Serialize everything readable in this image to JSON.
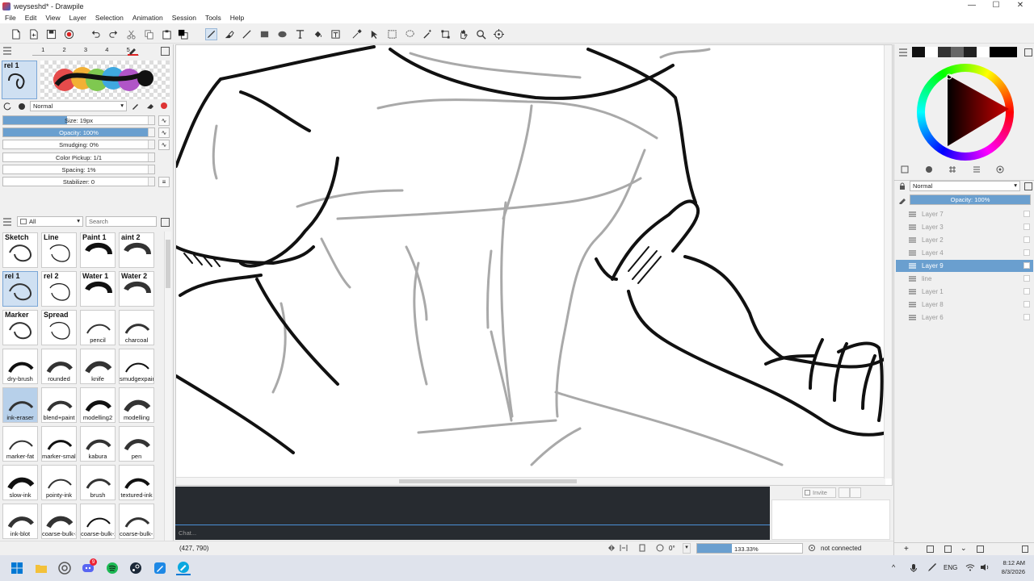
{
  "window": {
    "title": "weyseshd* - Drawpile",
    "min": "—",
    "max": "☐",
    "close": "✕"
  },
  "menu": [
    "File",
    "Edit",
    "View",
    "Layer",
    "Selection",
    "Animation",
    "Session",
    "Tools",
    "Help"
  ],
  "brush_editor": {
    "preset_label": "rel 1",
    "slot_numbers": [
      "1",
      "2",
      "3",
      "4",
      "5"
    ],
    "blend_mode": "Normal",
    "sliders": [
      {
        "label": "Size: 19px",
        "value": 0.42
      },
      {
        "label": "Opacity: 100%",
        "value": 1.0
      },
      {
        "label": "Smudging: 0%",
        "value": 0
      },
      {
        "label": "Color Pickup: 1/1",
        "value": 0
      },
      {
        "label": "Spacing: 1%",
        "value": 0
      },
      {
        "label": "Stabilizer: 0",
        "value": 0
      }
    ]
  },
  "brush_library": {
    "filter": "All",
    "search_placeholder": "Search",
    "brushes": [
      {
        "top": "Sketch",
        "bottom": ""
      },
      {
        "top": "Line",
        "bottom": ""
      },
      {
        "top": "Paint 1",
        "bottom": ""
      },
      {
        "top": "aint 2",
        "bottom": ""
      },
      {
        "top": "rel 1",
        "bottom": ""
      },
      {
        "top": "rel 2",
        "bottom": ""
      },
      {
        "top": "Water 1",
        "bottom": ""
      },
      {
        "top": "Water 2",
        "bottom": ""
      },
      {
        "top": "Marker",
        "bottom": ""
      },
      {
        "top": "Spread",
        "bottom": ""
      },
      {
        "top": "",
        "bottom": "pencil"
      },
      {
        "top": "",
        "bottom": "charcoal"
      },
      {
        "top": "",
        "bottom": "dry-brush"
      },
      {
        "top": "",
        "bottom": "rounded"
      },
      {
        "top": "",
        "bottom": "knife"
      },
      {
        "top": "",
        "bottom": "smudgexpaint"
      },
      {
        "top": "",
        "bottom": "ink-eraser"
      },
      {
        "top": "",
        "bottom": "blend+paint"
      },
      {
        "top": "",
        "bottom": "modelling2"
      },
      {
        "top": "",
        "bottom": "modelling"
      },
      {
        "top": "",
        "bottom": "marker-fat"
      },
      {
        "top": "",
        "bottom": "marker-small"
      },
      {
        "top": "",
        "bottom": "kabura"
      },
      {
        "top": "",
        "bottom": "pen"
      },
      {
        "top": "",
        "bottom": "slow-ink"
      },
      {
        "top": "",
        "bottom": "pointy-ink"
      },
      {
        "top": "",
        "bottom": "brush"
      },
      {
        "top": "",
        "bottom": "textured-ink"
      },
      {
        "top": "",
        "bottom": "ink-blot"
      },
      {
        "top": "",
        "bottom": "coarse-bulk-3"
      },
      {
        "top": "",
        "bottom": "coarse-bulk-2"
      },
      {
        "top": "",
        "bottom": "coarse-bulk-1"
      }
    ]
  },
  "chat": {
    "placeholder": "Chat...",
    "invite_label": "Invite"
  },
  "status": {
    "coords": "(427, 790)",
    "rotation": "0°",
    "zoom": "133.33%",
    "zoom_level": 0.33,
    "connection": "not connected"
  },
  "layers_panel": {
    "blend_mode": "Normal",
    "opacity_label": "Opacity: 100%",
    "layers": [
      {
        "name": "Layer 7",
        "selected": false
      },
      {
        "name": "Layer 3",
        "selected": false
      },
      {
        "name": "Layer 2",
        "selected": false
      },
      {
        "name": "Layer 4",
        "selected": false
      },
      {
        "name": "Layer 9",
        "selected": true
      },
      {
        "name": "line",
        "selected": false
      },
      {
        "name": "Layer 1",
        "selected": false
      },
      {
        "name": "Layer 8",
        "selected": false
      },
      {
        "name": "Layer 6",
        "selected": false
      }
    ]
  },
  "taskbar": {
    "lang": "ENG",
    "time": "8:12 AM",
    "date": "8/3/2026",
    "discord_badge": "9"
  },
  "colors": {
    "selection": "#6a9fcf",
    "chat_bg": "#272b30"
  }
}
